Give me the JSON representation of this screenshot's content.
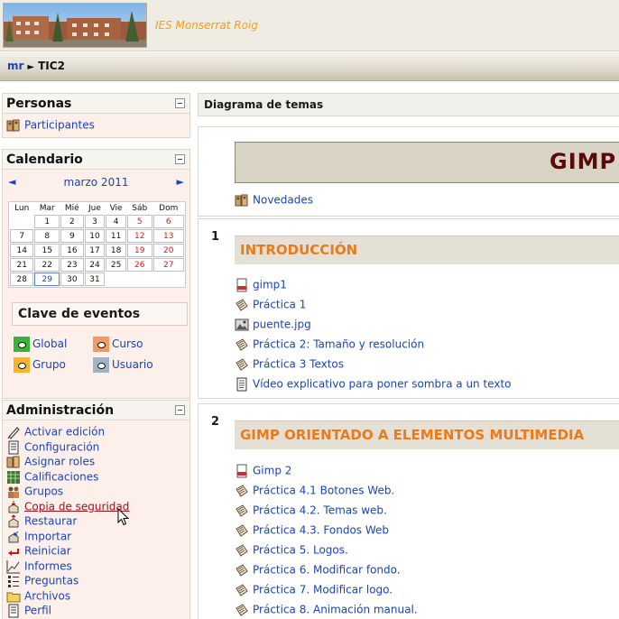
{
  "header": {
    "site_name": "IES Monserrat Roig"
  },
  "breadcrumb": {
    "root": "mr",
    "separator": "►",
    "current": "TIC2"
  },
  "people_block": {
    "title": "Personas",
    "participants": "Participantes"
  },
  "calendar_block": {
    "title": "Calendario",
    "prev": "◄",
    "next": "►",
    "month": "marzo 2011",
    "weekdays": [
      "Lun",
      "Mar",
      "Mié",
      "Jue",
      "Vie",
      "Sáb",
      "Dom"
    ],
    "weeks": [
      [
        "",
        "1",
        "2",
        "3",
        "4",
        "5",
        "6"
      ],
      [
        "7",
        "8",
        "9",
        "10",
        "11",
        "12",
        "13"
      ],
      [
        "14",
        "15",
        "16",
        "17",
        "18",
        "19",
        "20"
      ],
      [
        "21",
        "22",
        "23",
        "24",
        "25",
        "26",
        "27"
      ],
      [
        "28",
        "29",
        "30",
        "31",
        "",
        "",
        ""
      ]
    ],
    "today": "29",
    "event_key": {
      "title": "Clave de eventos",
      "global": "Global",
      "course": "Curso",
      "group": "Grupo",
      "user": "Usuario"
    }
  },
  "admin_block": {
    "title": "Administración",
    "items": [
      {
        "label": "Activar edición",
        "icon": "edit-icon"
      },
      {
        "label": "Configuración",
        "icon": "settings-icon"
      },
      {
        "label": "Asignar roles",
        "icon": "roles-icon"
      },
      {
        "label": "Calificaciones",
        "icon": "grades-icon"
      },
      {
        "label": "Grupos",
        "icon": "groups-icon"
      },
      {
        "label": "Copia de seguridad",
        "icon": "backup-icon"
      },
      {
        "label": "Restaurar",
        "icon": "restore-icon"
      },
      {
        "label": "Importar",
        "icon": "import-icon"
      },
      {
        "label": "Reiniciar",
        "icon": "reset-icon"
      },
      {
        "label": "Informes",
        "icon": "reports-icon"
      },
      {
        "label": "Preguntas",
        "icon": "questions-icon"
      },
      {
        "label": "Archivos",
        "icon": "folder-icon"
      },
      {
        "label": "Perfil",
        "icon": "profile-icon"
      }
    ]
  },
  "main": {
    "header": "Diagrama de temas",
    "intro": {
      "banner": "GIMP",
      "news": "Novedades"
    },
    "sections": [
      {
        "number": "1",
        "title": "INTRODUCCIÓN",
        "items": [
          {
            "label": "gimp1",
            "icon": "pdf-icon"
          },
          {
            "label": "Práctica 1",
            "icon": "assignment-icon"
          },
          {
            "label": "puente.jpg",
            "icon": "image-icon"
          },
          {
            "label": "Práctica 2: Tamaño y resolución",
            "icon": "assignment-icon"
          },
          {
            "label": "Práctica 3 Textos",
            "icon": "assignment-icon"
          },
          {
            "label": "Vídeo explicativo para poner sombra a un texto",
            "icon": "page-icon"
          }
        ]
      },
      {
        "number": "2",
        "title": "GIMP ORIENTADO A ELEMENTOS MULTIMEDIA",
        "items": [
          {
            "label": "Gimp 2",
            "icon": "pdf-icon"
          },
          {
            "label": "Práctica 4.1 Botones Web.",
            "icon": "assignment-icon"
          },
          {
            "label": "Práctica 4.2. Temas web.",
            "icon": "assignment-icon"
          },
          {
            "label": "Práctica 4.3. Fondos Web",
            "icon": "assignment-icon"
          },
          {
            "label": "Práctica 5. Logos.",
            "icon": "assignment-icon"
          },
          {
            "label": "Práctica 6. Modificar fondo.",
            "icon": "assignment-icon"
          },
          {
            "label": "Práctica 7. Modificar logo.",
            "icon": "assignment-icon"
          },
          {
            "label": "Práctica 8. Animación manual.",
            "icon": "assignment-icon"
          }
        ]
      }
    ]
  }
}
